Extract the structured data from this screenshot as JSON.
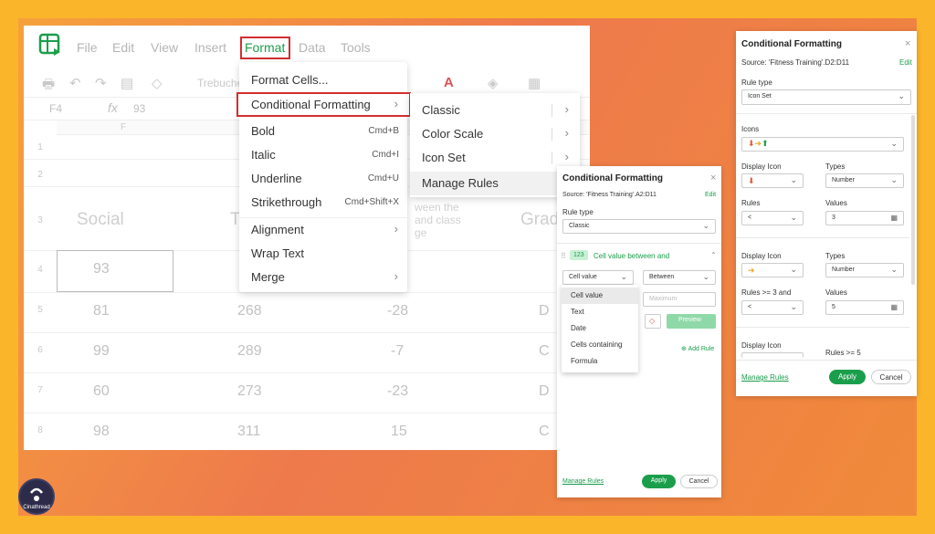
{
  "menu": [
    "File",
    "Edit",
    "View",
    "Insert",
    "Format",
    "Data",
    "Tools"
  ],
  "toolbar": {
    "font": "Trebuche",
    "a_label": "A"
  },
  "formula_bar": {
    "cell": "F4",
    "fx": "fx",
    "value": "93"
  },
  "column_letter": "F",
  "rows": [
    "1",
    "2",
    "3",
    "4",
    "5",
    "6",
    "7",
    "8"
  ],
  "grid": {
    "header_social": "Social",
    "header_t": "T",
    "header_grad": "Grad",
    "faded_line1": "ween the",
    "faded_line2": "and class",
    "faded_line3": "ge",
    "col1": [
      "93",
      "81",
      "99",
      "60",
      "98"
    ],
    "col2": [
      "268",
      "289",
      "273",
      "311"
    ],
    "col3": [
      "-28",
      "-7",
      "-23",
      "15"
    ],
    "col4": [
      "D",
      "C",
      "D",
      "C"
    ]
  },
  "format_menu": {
    "items": [
      {
        "label": "Format Cells...",
        "shortcut": ""
      },
      {
        "label": "Conditional Formatting",
        "shortcut": ""
      },
      {
        "label": "Bold",
        "shortcut": "Cmd+B"
      },
      {
        "label": "Italic",
        "shortcut": "Cmd+I"
      },
      {
        "label": "Underline",
        "shortcut": "Cmd+U"
      },
      {
        "label": "Strikethrough",
        "shortcut": "Cmd+Shift+X"
      },
      {
        "label": "Alignment",
        "shortcut": ""
      },
      {
        "label": "Wrap Text",
        "shortcut": ""
      },
      {
        "label": "Merge",
        "shortcut": ""
      }
    ]
  },
  "submenu": [
    "Classic",
    "Color Scale",
    "Icon Set",
    "Manage Rules"
  ],
  "panel_middle": {
    "title": "Conditional Formatting",
    "source": "Source:  'Fitness Training'.A2:D11",
    "edit": "Edit",
    "rule_type_label": "Rule type",
    "rule_type": "Classic",
    "badge": "123",
    "rule_title": "Cell value between and",
    "cond_select": "Cell value",
    "op_select": "Between",
    "max_placeholder": "Maximum",
    "preview": "Preview",
    "add_rule": "Add Rule",
    "manage_rules": "Manage Rules",
    "apply": "Apply",
    "cancel": "Cancel",
    "dropdown_options": [
      "Cell value",
      "Text",
      "Date",
      "Cells containing",
      "Formula"
    ]
  },
  "panel_right": {
    "title": "Conditional Formatting",
    "source": "Source:  'Fitness Training'.D2:D11",
    "edit": "Edit",
    "rule_type_label": "Rule type",
    "rule_type": "Icon Set",
    "icons_label": "Icons",
    "display_icon_label": "Display Icon",
    "types_label": "Types",
    "types_value": "Number",
    "rules_label": "Rules",
    "values_label": "Values",
    "rule1_op": "<",
    "rule1_val": "3",
    "rules2_label": "Rules >= 3 and",
    "rule2_op": "<",
    "rule2_val": "5",
    "rules3_label": "Rules >= 5",
    "manage_rules": "Manage Rules",
    "apply": "Apply",
    "cancel": "Cancel"
  },
  "brand": "Cinathread",
  "colors": {
    "green": "#1a9e4b",
    "red_highlight": "#d32f2f",
    "bg_orange": "#FBB52A"
  }
}
